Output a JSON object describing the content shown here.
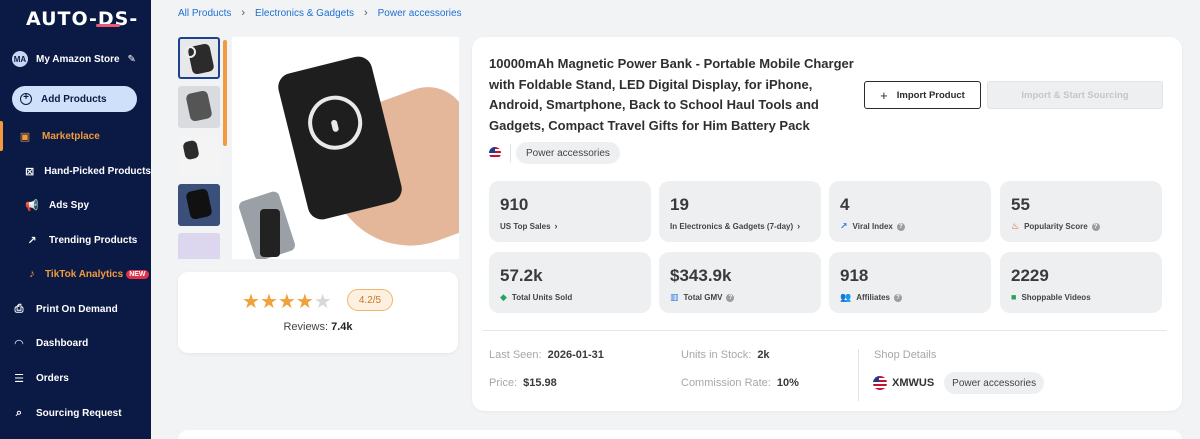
{
  "brand": {
    "logo_text": "AUTO-DS-"
  },
  "store": {
    "initials": "MA",
    "name": "My Amazon Store"
  },
  "sidebar": {
    "add_products_label": "Add Products",
    "items": [
      {
        "label": "Marketplace",
        "icon": "shop-icon",
        "active": true
      },
      {
        "label": "Hand-Picked Products",
        "icon": "hand-picked-icon"
      },
      {
        "label": "Ads Spy",
        "icon": "megaphone-icon"
      },
      {
        "label": "Trending Products",
        "icon": "trending-chart-icon"
      },
      {
        "label": "TikTok Analytics",
        "icon": "tiktok-icon",
        "badge": "NEW"
      },
      {
        "label": "Print On Demand",
        "icon": "print-icon"
      },
      {
        "label": "Dashboard",
        "icon": "dashboard-gauge-icon"
      },
      {
        "label": "Orders",
        "icon": "orders-list-icon"
      },
      {
        "label": "Sourcing Request",
        "icon": "sourcing-icon"
      }
    ]
  },
  "breadcrumb": [
    "All Products",
    "Electronics & Gadgets",
    "Power accessories"
  ],
  "product": {
    "title": "10000mAh Magnetic Power Bank - Portable Mobile Charger with Foldable Stand, LED Digital Display, for iPhone, Android, Smartphone, Back to School Haul Tools and Gadgets, Compact Travel Gifts for Him Battery Pack",
    "category_tag": "Power accessories",
    "import_label": "Import Product",
    "import_source_label": "Import & Start Sourcing",
    "rating": {
      "value": 4.2,
      "stars_filled": 4,
      "stars_total": 5,
      "pill_text": "4.2/5",
      "reviews_label": "Reviews:",
      "reviews_count": "7.4k"
    }
  },
  "stats": [
    {
      "value": "910",
      "label": "US Top Sales",
      "icon": "",
      "suffix": "chevron"
    },
    {
      "value": "19",
      "label": "In Electronics & Gadgets (7-day)",
      "icon": "",
      "suffix": "chevron"
    },
    {
      "value": "4",
      "label": "Viral Index",
      "icon": "viral-trend-icon",
      "suffix": "help"
    },
    {
      "value": "55",
      "label": "Popularity Score",
      "icon": "flame-icon",
      "suffix": "help"
    },
    {
      "value": "57.2k",
      "label": "Total Units Sold",
      "icon": "tag-icon",
      "suffix": ""
    },
    {
      "value": "$343.9k",
      "label": "Total GMV",
      "icon": "bar-chart-icon",
      "suffix": "help"
    },
    {
      "value": "918",
      "label": "Affiliates",
      "icon": "users-icon",
      "suffix": "help"
    },
    {
      "value": "2229",
      "label": "Shoppable Videos",
      "icon": "video-icon",
      "suffix": ""
    }
  ],
  "details": {
    "last_seen_label": "Last Seen:",
    "last_seen": "2026-01-31",
    "units_label": "Units in Stock:",
    "units": "2k",
    "price_label": "Price:",
    "price": "$15.98",
    "commission_label": "Commission Rate:",
    "commission": "10%",
    "shop_details_label": "Shop Details",
    "shop_name": "XMWUS",
    "shop_tag": "Power accessories"
  },
  "colors": {
    "sidebar_bg": "#0b1a44",
    "accent": "#f29a3c",
    "link": "#1f6fd1"
  }
}
